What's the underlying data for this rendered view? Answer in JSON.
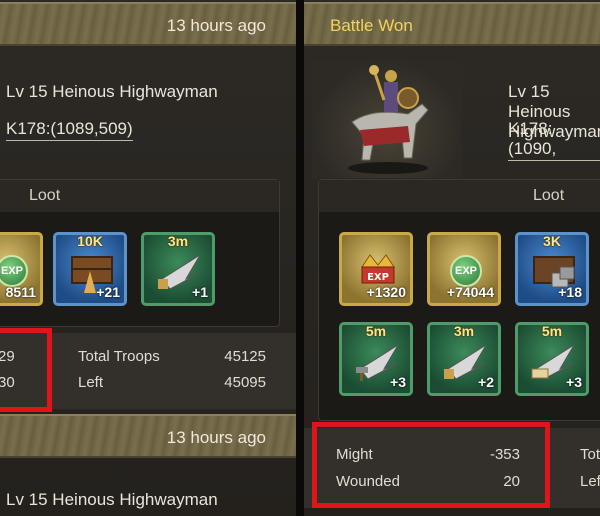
{
  "left": {
    "time": "13 hours ago",
    "target_name": "Lv 15 Heinous Highwayman",
    "coords": "K178:(1089,509)",
    "loot_title": "Loot",
    "items": [
      {
        "icon": "exp-icon",
        "qty": "8511"
      },
      {
        "icon": "food-crate-icon",
        "tag": "10K",
        "qty": "+21"
      },
      {
        "icon": "speedup-helmet-icon",
        "tag": "3m",
        "qty": "+1"
      }
    ],
    "left_stats": [
      "29",
      "30"
    ],
    "right_stats": [
      {
        "label": "Total Troops",
        "value": "45125"
      },
      {
        "label": "Left",
        "value": "45095"
      }
    ],
    "time2": "13 hours ago",
    "target_name2": "Lv 15 Heinous Highwayman"
  },
  "right": {
    "title": "Battle Won",
    "target_name": "Lv 15 Heinous Highwayman",
    "coords": "K178:(1090,",
    "loot_title": "Loot",
    "items_row1": [
      {
        "icon": "exp-crown-icon",
        "tag": "",
        "qty": "+1320"
      },
      {
        "icon": "exp-icon",
        "tag": "",
        "qty": "+74044"
      },
      {
        "icon": "stone-crate-icon",
        "tag": "3K",
        "qty": "+18"
      }
    ],
    "items_row2": [
      {
        "icon": "speedup-hammer-icon",
        "tag": "5m",
        "qty": "+3"
      },
      {
        "icon": "speedup-helmet-icon",
        "tag": "3m",
        "qty": "+2"
      },
      {
        "icon": "speedup-scroll-icon",
        "tag": "5m",
        "qty": "+3"
      }
    ],
    "stats": [
      {
        "label": "Might",
        "value": "-353"
      },
      {
        "label": "Wounded",
        "value": "20"
      }
    ],
    "cut_labels": [
      "Tot",
      "Lef"
    ]
  },
  "colors": {
    "highlight": "#e0141b",
    "title_gold": "#f2d35b"
  }
}
